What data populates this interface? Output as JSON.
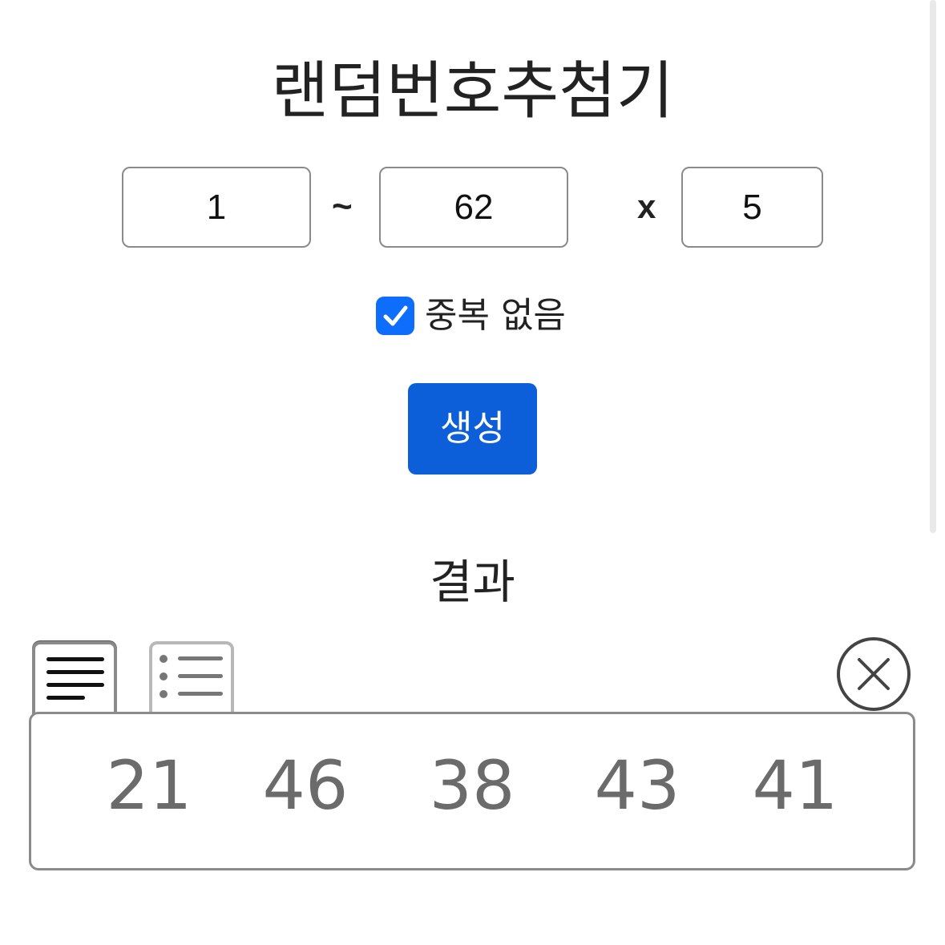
{
  "title": "랜덤번호추첨기",
  "range": {
    "min": "1",
    "separator": "~",
    "max": "62",
    "times_symbol": "x",
    "count": "5"
  },
  "options": {
    "no_duplicates_label": "중복 없음",
    "no_duplicates_checked": true
  },
  "generate_button_label": "생성",
  "result": {
    "heading": "결과",
    "view_tabs": [
      {
        "icon": "text-align-left-icon",
        "active": true
      },
      {
        "icon": "bulleted-list-icon",
        "active": false
      }
    ],
    "clear_icon": "close-circle-icon",
    "numbers": [
      "21",
      "46",
      "38",
      "43",
      "41"
    ]
  },
  "colors": {
    "accent": "#0d5fd9",
    "checkbox": "#0d6efd",
    "result_text": "#6b6b6b",
    "border": "#8a8a8a"
  }
}
